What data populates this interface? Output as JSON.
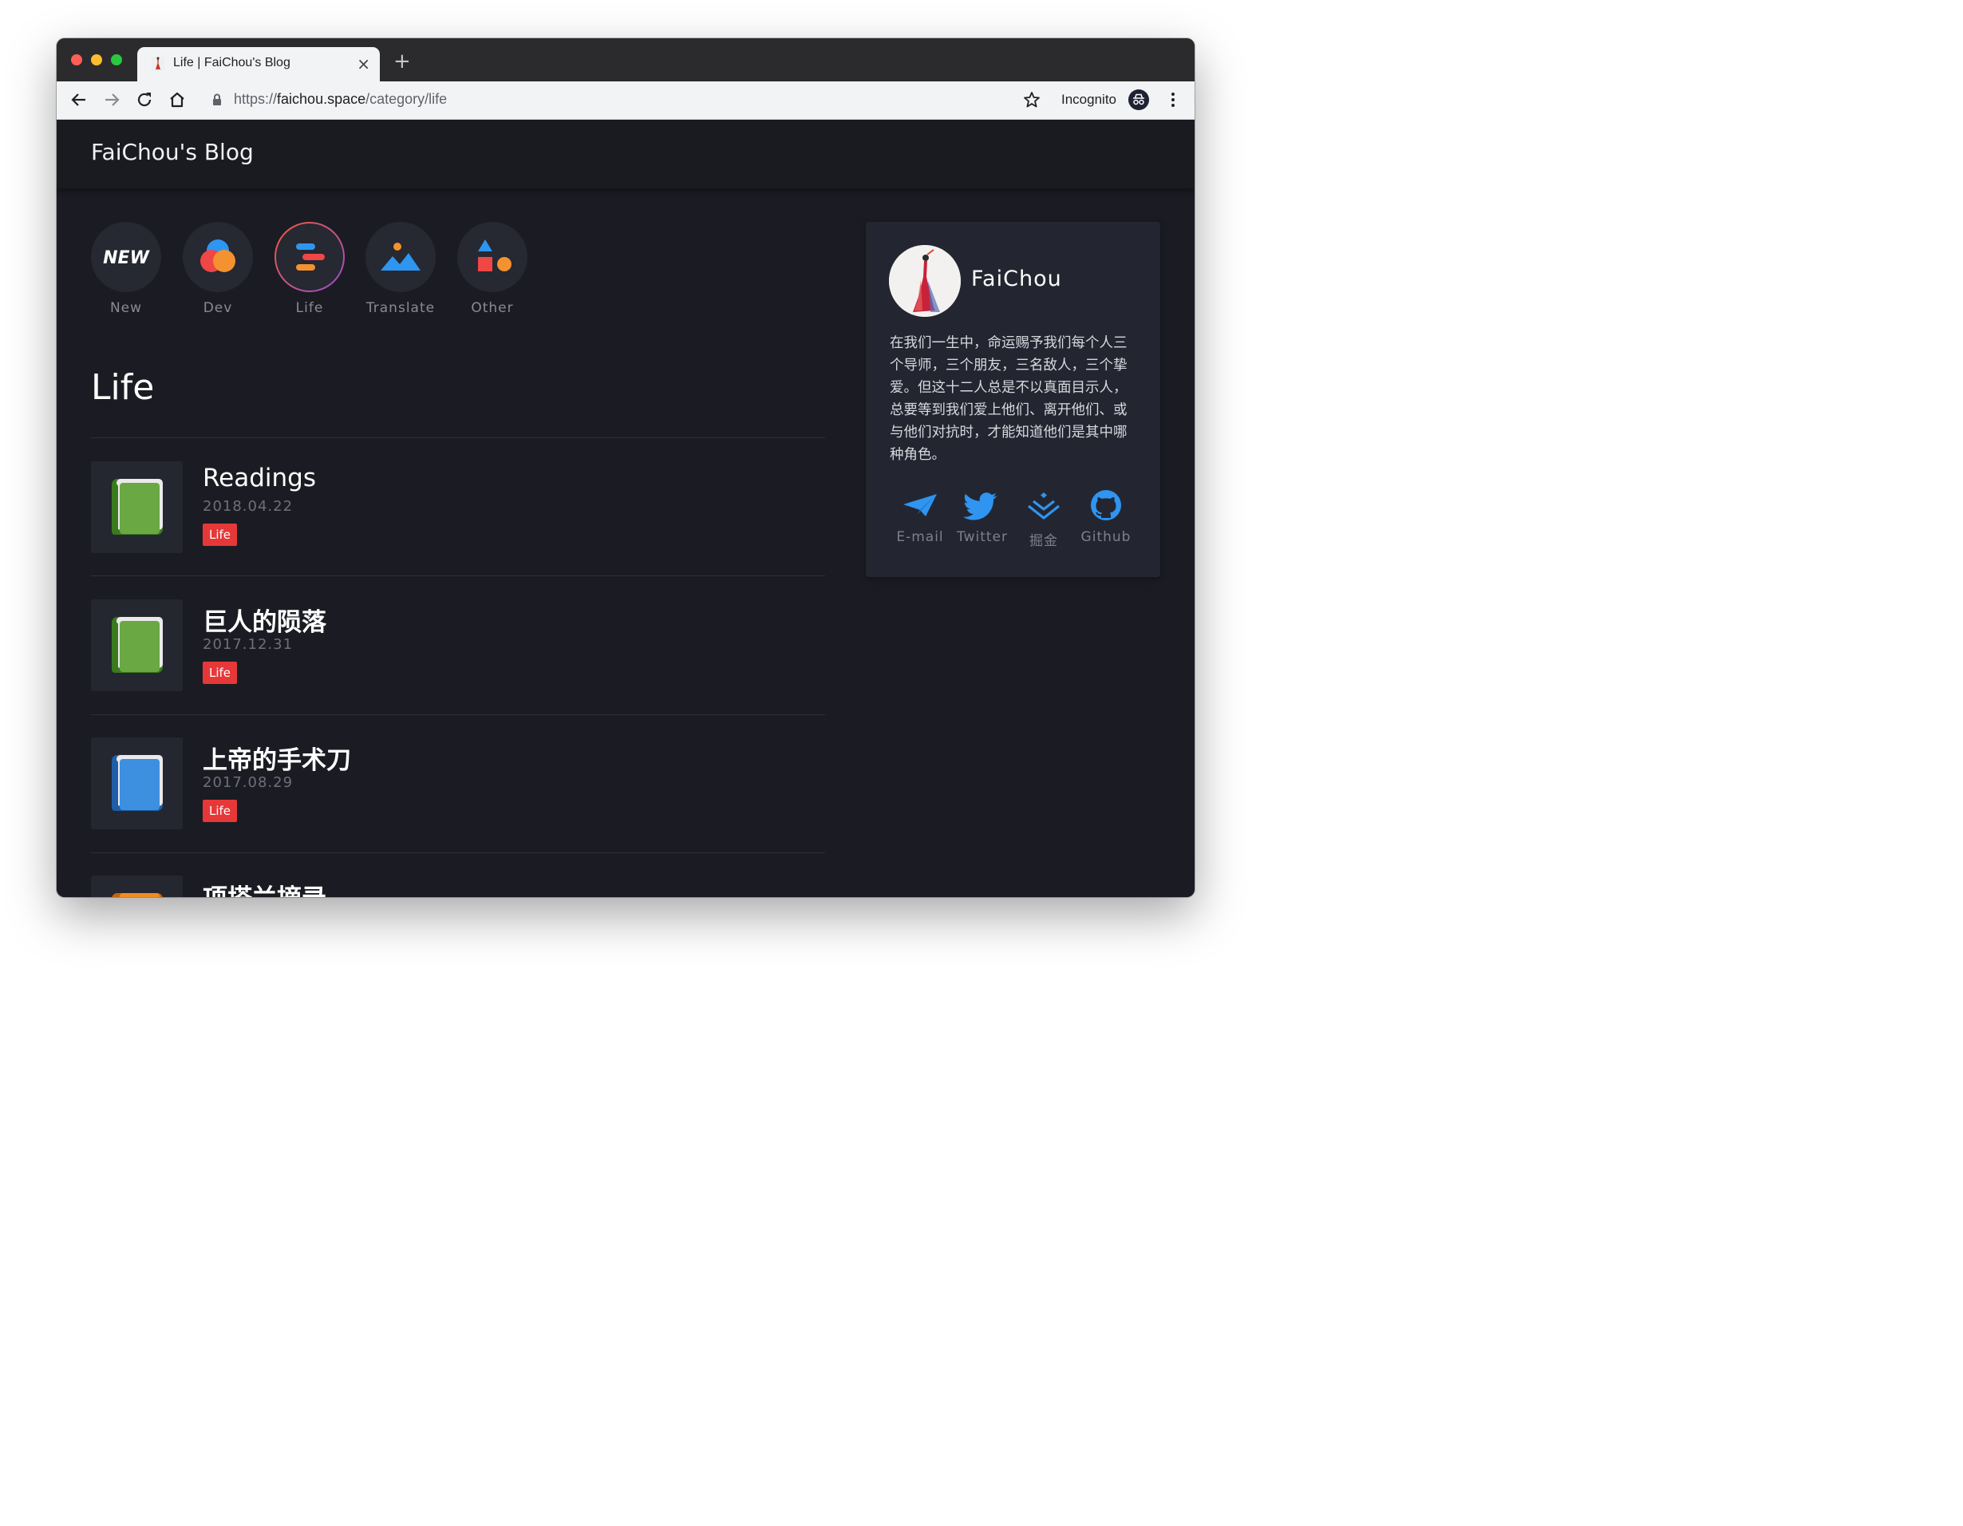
{
  "browser": {
    "tab_title": "Life | FaiChou's Blog",
    "tab_close": "×",
    "new_tab": "+",
    "url_scheme": "https://",
    "url_host": "faichou.space",
    "url_path": "/category/life",
    "incognito_label": "Incognito"
  },
  "site": {
    "title": "FaiChou's Blog"
  },
  "categories": [
    {
      "label": "New",
      "icon": "new-badge-icon",
      "badge_text": "NEW"
    },
    {
      "label": "Dev",
      "icon": "overlapping-circles-icon"
    },
    {
      "label": "Life",
      "icon": "stacked-bars-icon",
      "active": true
    },
    {
      "label": "Translate",
      "icon": "mountain-landscape-icon"
    },
    {
      "label": "Other",
      "icon": "shapes-icon"
    }
  ],
  "page": {
    "heading": "Life"
  },
  "posts": [
    {
      "title": "Readings",
      "date": "2018.04.22",
      "tag": "Life",
      "book_color": "#6aa843"
    },
    {
      "title": "巨人的陨落",
      "date": "2017.12.31",
      "tag": "Life",
      "book_color": "#6aa843"
    },
    {
      "title": "上帝的手术刀",
      "date": "2017.08.29",
      "tag": "Life",
      "book_color": "#3d8fe0"
    },
    {
      "title": "项塔兰摘录",
      "date": "",
      "tag": "",
      "book_color": "#f28c1e"
    }
  ],
  "sidebar": {
    "author": "FaiChou",
    "bio": "在我们一生中，命运赐予我们每个人三个导师，三个朋友，三名敌人，三个挚爱。但这十二人总是不以真面目示人，总要等到我们爱上他们、离开他们、或与他们对抗时，才能知道他们是其中哪种角色。",
    "social": [
      {
        "label": "E-mail",
        "icon": "paper-plane-icon"
      },
      {
        "label": "Twitter",
        "icon": "twitter-bird-icon"
      },
      {
        "label": "掘金",
        "icon": "juejin-icon"
      },
      {
        "label": "Github",
        "icon": "github-icon"
      }
    ]
  },
  "colors": {
    "page_bg": "#1b1c23",
    "card_bg": "#232631",
    "tag_red": "#e63838",
    "social_blue": "#2f95f0"
  }
}
